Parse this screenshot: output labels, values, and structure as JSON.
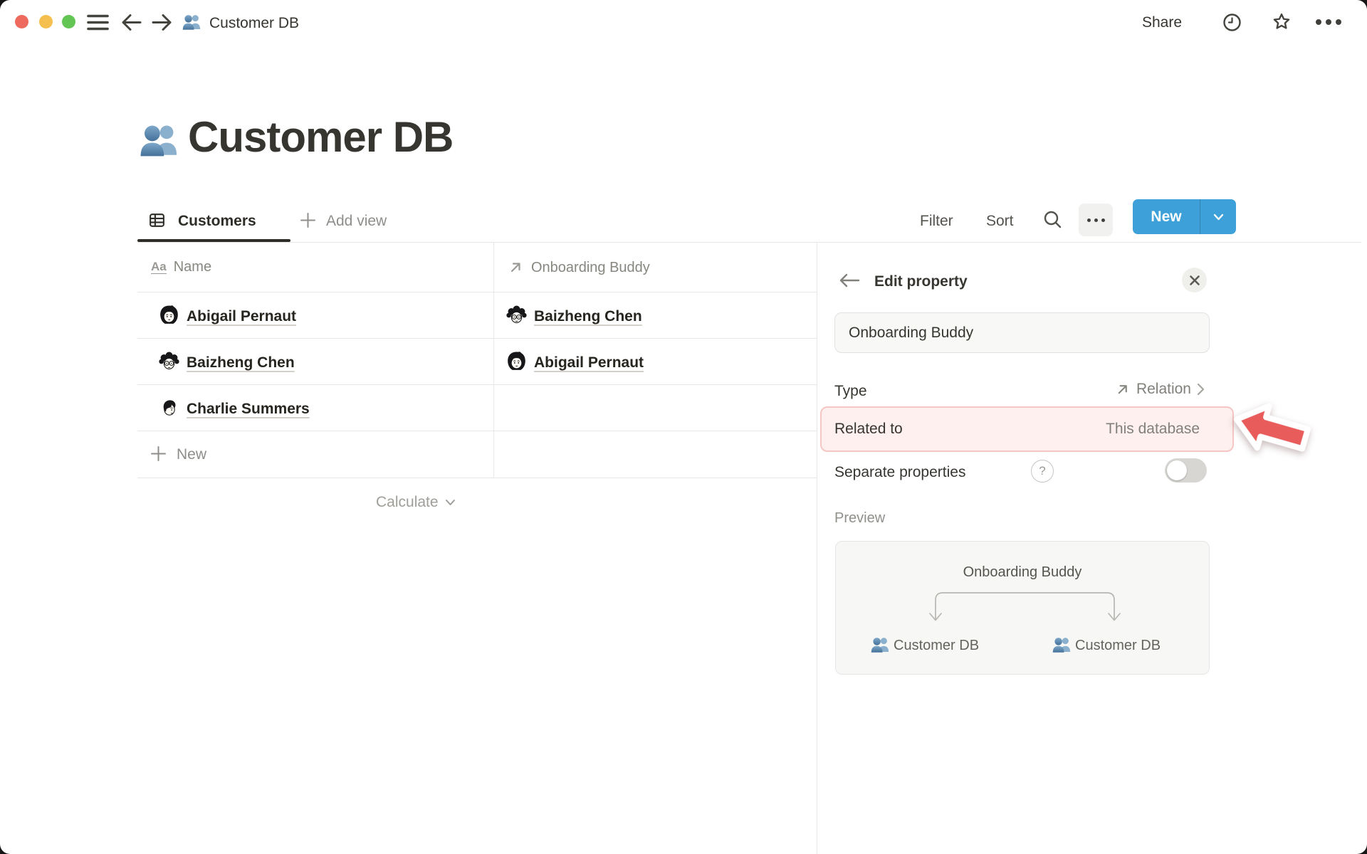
{
  "titlebar": {
    "document_title": "Customer DB",
    "document_icon": "people-icon",
    "share_label": "Share",
    "icons": [
      "clock-icon",
      "star-icon",
      "ellipsis-icon"
    ]
  },
  "page": {
    "title": "Customer DB",
    "icon": "people-icon"
  },
  "view_bar": {
    "active_tab": {
      "label": "Customers",
      "icon": "table-view-icon"
    },
    "add_view_label": "Add view",
    "filter_label": "Filter",
    "sort_label": "Sort",
    "search_icon": "search-icon",
    "more_icon": "ellipsis-icon",
    "new_button_label": "New"
  },
  "table": {
    "columns": [
      {
        "label": "Name",
        "icon": "title-property-icon"
      },
      {
        "label": "Onboarding Buddy",
        "icon": "relation-property-icon"
      }
    ],
    "rows": [
      {
        "name": "Abigail Pernaut",
        "name_avatar": "abigail-avatar",
        "buddy": "Baizheng Chen",
        "buddy_avatar": "baizheng-avatar"
      },
      {
        "name": "Baizheng Chen",
        "name_avatar": "baizheng-avatar",
        "buddy": "Abigail Pernaut",
        "buddy_avatar": "abigail-avatar"
      },
      {
        "name": "Charlie Summers",
        "name_avatar": "charlie-avatar",
        "buddy": "",
        "buddy_avatar": ""
      }
    ],
    "new_row_label": "New",
    "calculate_label": "Calculate"
  },
  "edit_property_panel": {
    "title": "Edit property",
    "name_input": {
      "value": "Onboarding Buddy"
    },
    "type_row": {
      "label": "Type",
      "value": "Relation",
      "value_icon": "relation-icon"
    },
    "related_to_row": {
      "label": "Related to",
      "value": "This database",
      "highlighted": true
    },
    "separate_properties_row": {
      "label": "Separate properties",
      "toggle_state": "off",
      "help_icon": "question-icon"
    },
    "preview": {
      "label": "Preview",
      "relation_name": "Onboarding Buddy",
      "source_item": {
        "label": "Customer DB",
        "icon": "people-icon"
      },
      "target_item": {
        "label": "Customer DB",
        "icon": "people-icon"
      }
    },
    "annotation": {
      "arrow": "red-arrow-pointing-left"
    }
  },
  "colors": {
    "accent_blue": "#3da0d8",
    "highlight_pink_bg": "#fdf0ee",
    "highlight_pink_border": "#f5c7c3",
    "annotation_red": "#e85d5c",
    "text_primary": "#37352f",
    "text_secondary": "#87867f",
    "traffic_red": "#ee6a5f",
    "traffic_yellow": "#f5bf4f",
    "traffic_green": "#62c554"
  }
}
